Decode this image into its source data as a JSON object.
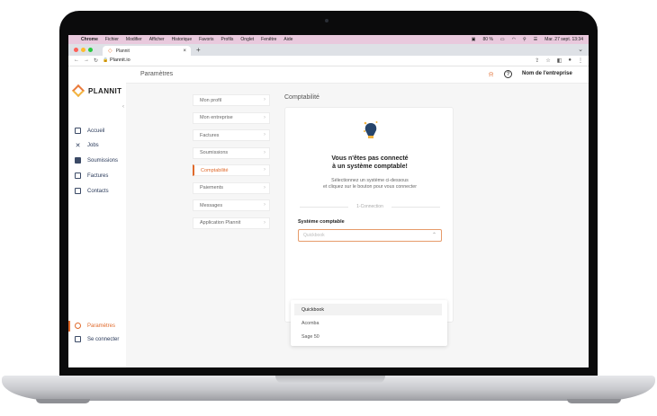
{
  "os_menu": {
    "app_name": "Chrome",
    "items": [
      "Fichier",
      "Modifier",
      "Afficher",
      "Historique",
      "Favoris",
      "Profils",
      "Onglet",
      "Fenêtre",
      "Aide"
    ],
    "battery": "80 %",
    "datetime": "Mar. 27 sept.  13:34"
  },
  "browser": {
    "tab_title": "Plannit",
    "url": "Plannit.io"
  },
  "sidebar": {
    "brand": "PLANNIT",
    "items": [
      {
        "label": "Accueil"
      },
      {
        "label": "Jobs"
      },
      {
        "label": "Soumissions"
      },
      {
        "label": "Factures"
      },
      {
        "label": "Contacts"
      }
    ],
    "bottom_items": [
      {
        "label": "Paramètres"
      },
      {
        "label": "Se connecter"
      }
    ]
  },
  "header": {
    "title": "Paramètres",
    "company": "Nom de l'entreprise"
  },
  "settings_menu": [
    {
      "label": "Mon profil"
    },
    {
      "label": "Mon entreprise"
    },
    {
      "label": "Factures"
    },
    {
      "label": "Soumissions"
    },
    {
      "label": "Comptabilité"
    },
    {
      "label": "Paiements"
    },
    {
      "label": "Messages"
    },
    {
      "label": "Application Plannit"
    }
  ],
  "main": {
    "section_title": "Comptabilité",
    "heading_line1": "Vous n'êtes pas connecté",
    "heading_line2": "à un système comptable!",
    "desc_line1": "Sélectionnez un système ci-dessous",
    "desc_line2": "et cliquez sur le bouton pour vous connecter",
    "divider_label": "1-Connection",
    "field_label": "Système comptable",
    "select_placeholder": "Quickbook",
    "options": [
      "Quickbook",
      "Acomba",
      "Sage 50"
    ]
  },
  "colors": {
    "accent": "#e06a2c",
    "menubar": "#e9c9dd"
  }
}
